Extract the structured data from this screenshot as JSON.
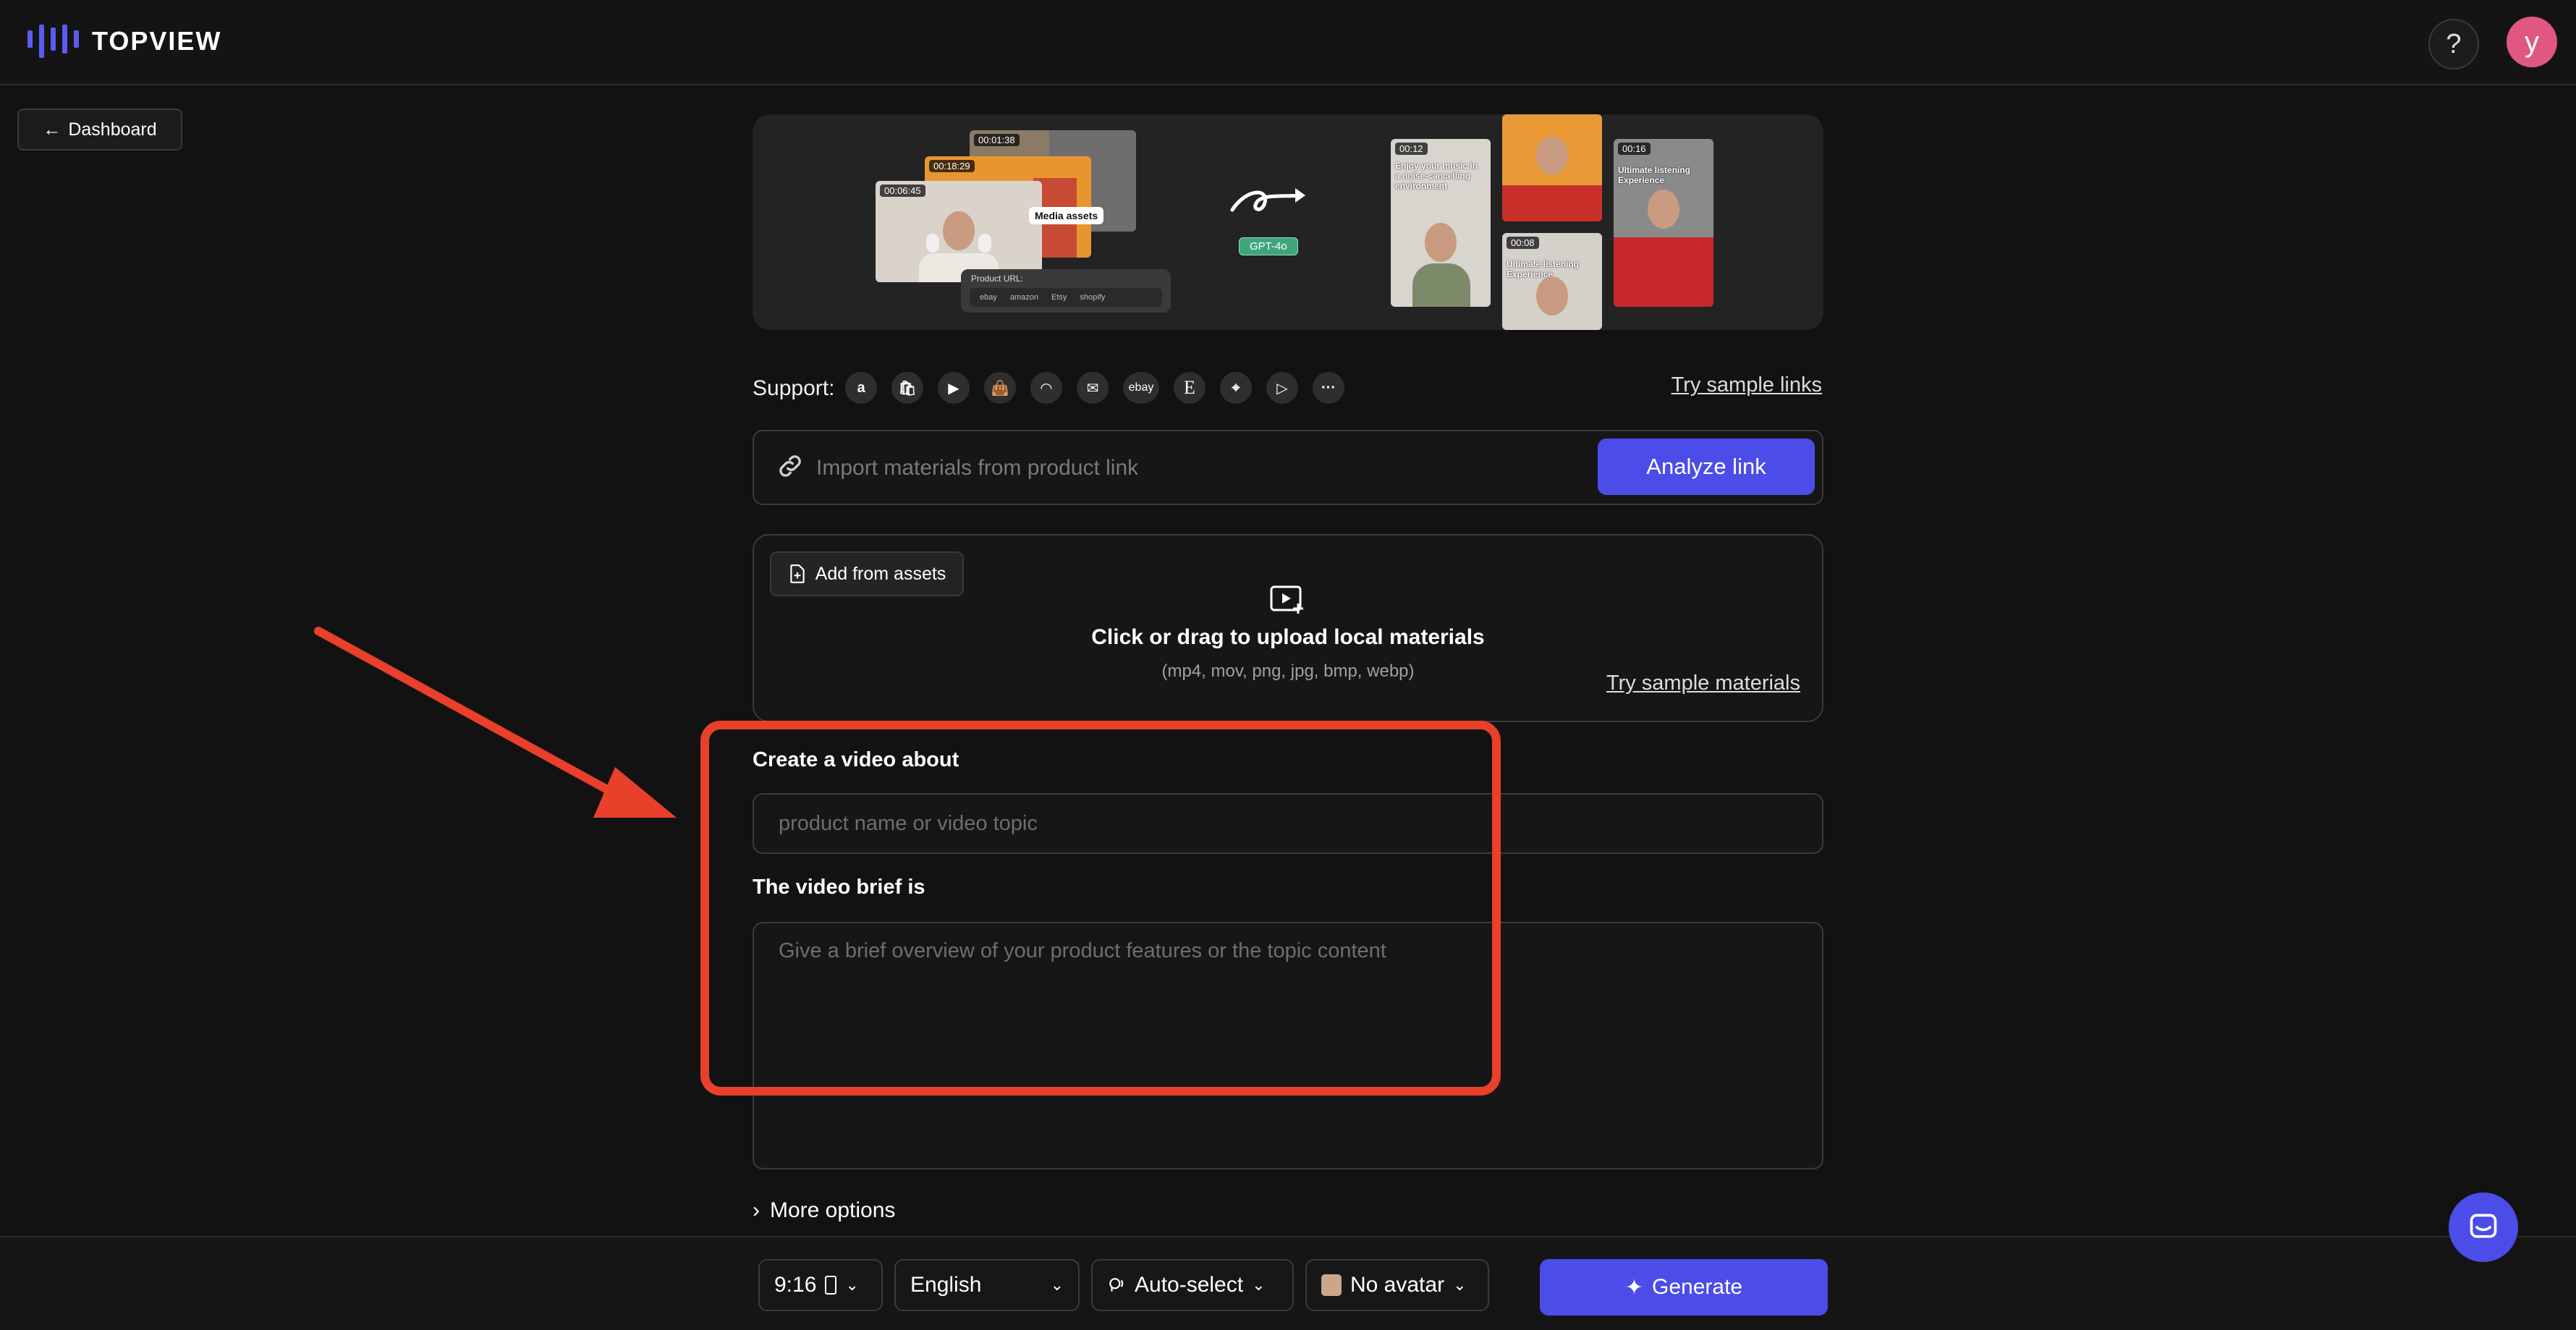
{
  "app": {
    "logo_text": "TOPVIEW"
  },
  "header": {
    "help_label": "?",
    "user_initial": "y"
  },
  "nav": {
    "dashboard_label": "Dashboard"
  },
  "banner": {
    "timestamps_left": [
      "00:01:38",
      "00:18:29",
      "00:06:45"
    ],
    "media_assets_label": "Media assets",
    "product_url_label": "Product URL:",
    "product_url_brands": [
      "ebay",
      "amazon",
      "Etsy",
      "shopify"
    ],
    "model_badge": "GPT-4o",
    "timestamps_right": [
      "00:12",
      "00:08",
      "00:16"
    ],
    "caption_1": "Enjoy your music in a noise-cancelling environment",
    "caption_2": "Ultimate listening Experience",
    "caption_3": "Ultimate listening Experience"
  },
  "support": {
    "label": "Support:",
    "icons": [
      "amazon-icon",
      "shopify-icon",
      "youtube-icon",
      "shopee-icon",
      "tokopedia-icon",
      "mail-icon",
      "ebay-icon",
      "etsy-icon",
      "appstore-icon",
      "googleplay-icon",
      "more-icon"
    ],
    "ebay_text": "ebay",
    "etsy_text": "E",
    "more_text": "···",
    "try_links": "Try sample links"
  },
  "link_import": {
    "placeholder": "Import materials from product link",
    "button": "Analyze link"
  },
  "upload": {
    "assets_button": "Add from assets",
    "title": "Click or drag to upload local materials",
    "formats": "(mp4, mov, png, jpg, bmp, webp)",
    "try_materials": "Try sample materials"
  },
  "form": {
    "topic_label": "Create a video about",
    "topic_placeholder": "product name or video topic",
    "brief_label": "The video brief is",
    "brief_placeholder": "Give a brief overview of your product features or the topic content",
    "more_options": "More options"
  },
  "annotation": {
    "highlight_color": "#e8402a"
  },
  "bottom": {
    "ratio": "9:16",
    "language": "English",
    "voice": "Auto-select",
    "avatar": "No avatar",
    "generate": "Generate"
  },
  "colors": {
    "accent": "#4c4ce8",
    "avatar_bg": "#e0577f"
  }
}
